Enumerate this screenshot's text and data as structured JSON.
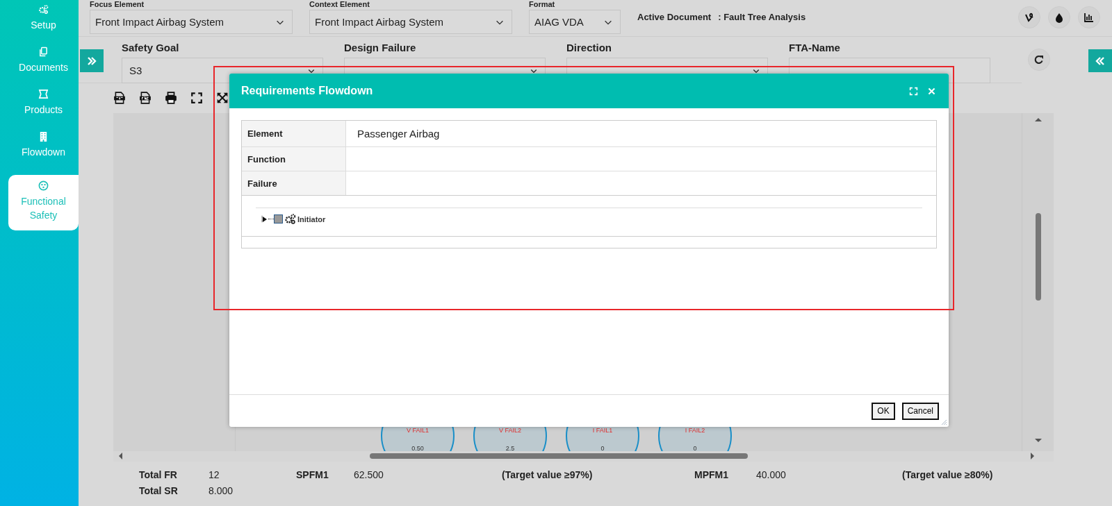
{
  "sidebar": {
    "items": [
      {
        "label": "Setup",
        "selected": false
      },
      {
        "label": "Documents",
        "selected": false
      },
      {
        "label": "Products",
        "selected": false
      },
      {
        "label": "Flowdown",
        "selected": false
      },
      {
        "label": "Functional Safety",
        "selected": true
      }
    ]
  },
  "top_bar": {
    "fields": [
      {
        "label": "Focus Element",
        "value": "Front Impact Airbag System"
      },
      {
        "label": "Context Element",
        "value": "Front Impact Airbag System"
      },
      {
        "label": "Format",
        "value": "AIAG VDA"
      }
    ],
    "active_document": {
      "label": "Active Document",
      "value": ": Fault Tree Analysis"
    }
  },
  "filter_bar": {
    "fields": [
      {
        "label": "Safety Goal",
        "kind": "select",
        "value": "S3"
      },
      {
        "label": "Design Failure",
        "kind": "select"
      },
      {
        "label": "Direction",
        "kind": "select"
      },
      {
        "label": "FTA-Name",
        "kind": "input"
      }
    ]
  },
  "diagram": {
    "nodes": [
      {
        "label": "V FAIL1",
        "value": "0.50"
      },
      {
        "label": "V FAIL2",
        "value": "2.5"
      },
      {
        "label": "I FAIL1",
        "value": "0"
      },
      {
        "label": "I FAIL2",
        "value": "0"
      }
    ]
  },
  "summary": {
    "rows": [
      [
        {
          "label": "Total FR",
          "value": "12"
        },
        {
          "label": "SPFM1",
          "value": "62.500"
        },
        {
          "note": "(Target value ≥97%)"
        },
        {
          "label": "MPFM1",
          "value": "40.000"
        },
        {
          "note": "(Target value ≥80%)"
        }
      ],
      [
        {
          "label": "Total SR",
          "value": "8.000"
        }
      ]
    ]
  },
  "modal": {
    "title": "Requirements Flowdown",
    "rows": [
      {
        "label": "Element",
        "value": "Passenger Airbag"
      },
      {
        "label": "Function"
      },
      {
        "label": "Failure"
      }
    ],
    "tree": [
      {
        "label": "Initiator",
        "expanded": false,
        "checked": false
      }
    ],
    "buttons": [
      "OK",
      "Cancel"
    ]
  }
}
